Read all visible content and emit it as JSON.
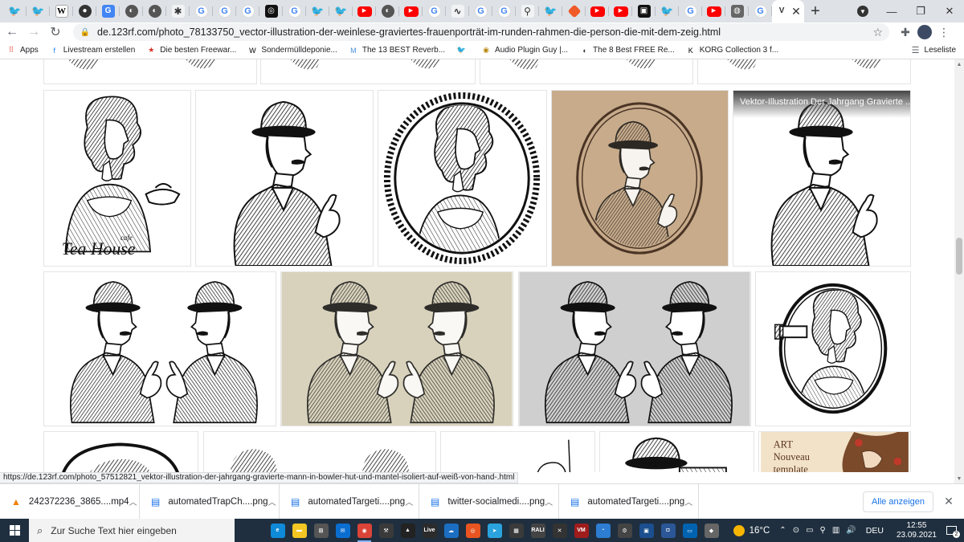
{
  "tabs": [
    {
      "icon": "twitter-icon",
      "glyph": "🐦",
      "cls": "twitter"
    },
    {
      "icon": "twitter-icon",
      "glyph": "🐦",
      "cls": "twitter"
    },
    {
      "icon": "wikipedia-icon",
      "glyph": "W",
      "cls": "wiki"
    },
    {
      "icon": "github-icon",
      "glyph": "●",
      "cls": "github"
    },
    {
      "icon": "translate-icon",
      "glyph": "G",
      "cls": "translate"
    },
    {
      "icon": "globe-icon",
      "glyph": "◐",
      "cls": "globe"
    },
    {
      "icon": "globe-icon",
      "glyph": "◐",
      "cls": "globe"
    },
    {
      "icon": "sparkle-icon",
      "glyph": "✱",
      "cls": "multi"
    },
    {
      "icon": "google-icon",
      "glyph": "G",
      "cls": "google"
    },
    {
      "icon": "google-icon",
      "glyph": "G",
      "cls": "google"
    },
    {
      "icon": "google-icon",
      "glyph": "G",
      "cls": "google"
    },
    {
      "icon": "openai-icon",
      "glyph": "◎",
      "cls": "dark"
    },
    {
      "icon": "google-icon",
      "glyph": "G",
      "cls": "google"
    },
    {
      "icon": "twitter-icon",
      "glyph": "🐦",
      "cls": "twitter"
    },
    {
      "icon": "twitter-icon",
      "glyph": "🐦",
      "cls": "twitter"
    },
    {
      "icon": "youtube-icon",
      "glyph": "▶",
      "cls": "youtube"
    },
    {
      "icon": "globe-icon",
      "glyph": "◐",
      "cls": "globe"
    },
    {
      "icon": "youtube-icon",
      "glyph": "▶",
      "cls": "youtube"
    },
    {
      "icon": "google-icon",
      "glyph": "G",
      "cls": "google"
    },
    {
      "icon": "signature-icon",
      "glyph": "∿",
      "cls": "multi"
    },
    {
      "icon": "google-icon",
      "glyph": "G",
      "cls": "google"
    },
    {
      "icon": "google-icon",
      "glyph": "G",
      "cls": "google"
    },
    {
      "icon": "figure-icon",
      "glyph": "⚲",
      "cls": "multi"
    },
    {
      "icon": "twitter-icon",
      "glyph": "🐦",
      "cls": "twitter"
    },
    {
      "icon": "git-icon",
      "glyph": "",
      "cls": "orange"
    },
    {
      "icon": "youtube-icon",
      "glyph": "▶",
      "cls": "youtube"
    },
    {
      "icon": "youtube-icon",
      "glyph": "▶",
      "cls": "youtube"
    },
    {
      "icon": "box-icon",
      "glyph": "▣",
      "cls": "dark"
    },
    {
      "icon": "twitter-icon",
      "glyph": "🐦",
      "cls": "twitter"
    },
    {
      "icon": "google-icon",
      "glyph": "G",
      "cls": "google"
    },
    {
      "icon": "youtube-icon",
      "glyph": "▶",
      "cls": "youtube"
    },
    {
      "icon": "gamepad-icon",
      "glyph": "◍",
      "cls": "gray"
    },
    {
      "icon": "google-icon",
      "glyph": "G",
      "cls": "google"
    }
  ],
  "active_tab": {
    "icon": "vector-icon",
    "glyph": "V"
  },
  "toolbar": {
    "url_host": "de.123rf.com",
    "url_path": "/photo_78133750_vector-illustration-der-weinlese-graviertes-frauenporträt-im-runden-rahmen-die-person-die-mit-dem-zeig.html"
  },
  "bookmarks": [
    {
      "label": "Apps",
      "icon": "apps-grid-icon",
      "glyph": "⠿",
      "color": "#ea4335"
    },
    {
      "label": "Livestream erstellen",
      "icon": "facebook-icon",
      "glyph": "f",
      "color": "#1877f2"
    },
    {
      "label": "Die besten Freewar...",
      "icon": "star-icon",
      "glyph": "★",
      "color": "#d93025"
    },
    {
      "label": "Sondermülldeponie...",
      "icon": "wikipedia-icon",
      "glyph": "W",
      "color": "#000000"
    },
    {
      "label": "The 13 BEST Reverb...",
      "icon": "m-icon",
      "glyph": "M",
      "color": "#4a90d9"
    },
    {
      "label": "",
      "icon": "twitter-icon",
      "glyph": "🐦",
      "color": "#1d9bf0"
    },
    {
      "label": "Audio Plugin Guy |...",
      "icon": "plugin-icon",
      "glyph": "◉",
      "color": "#b8860b"
    },
    {
      "label": "The 8 Best FREE Re...",
      "icon": "moon-icon",
      "glyph": "◖",
      "color": "#333333"
    },
    {
      "label": "KORG Collection 3 f...",
      "icon": "korg-icon",
      "glyph": "K",
      "color": "#000000"
    }
  ],
  "reading_list": "Leseliste",
  "tile_overlay_title": "Vektor-Illustration Der Jahrgang Gravierte ...",
  "status_url": "https://de.123rf.com/photo_57512821_vektor-illustration-der-jahrgang-gravierte-mann-in-bowler-hut-und-mantel-isoliert-auf-weiß-von-hand-.html",
  "tile_text": {
    "teahouse": "Tea House",
    "cafe": "cafe",
    "art_line1": "ART",
    "art_line2": "Nouveau",
    "art_line3": "template"
  },
  "downloads": [
    {
      "name": "242372236_3865....mp4",
      "icon": "vlc-icon",
      "glyph": "▲",
      "color": "#f08000"
    },
    {
      "name": "automatedTrapCh....png",
      "icon": "file-icon",
      "glyph": "▤",
      "color": "#1a73e8"
    },
    {
      "name": "automatedTargeti....png",
      "icon": "file-icon",
      "glyph": "▤",
      "color": "#1a73e8"
    },
    {
      "name": "twitter-socialmedi....png",
      "icon": "file-icon",
      "glyph": "▤",
      "color": "#1a73e8"
    },
    {
      "name": "automatedTargeti....png",
      "icon": "file-icon",
      "glyph": "▤",
      "color": "#1a73e8"
    }
  ],
  "show_all": "Alle anzeigen",
  "taskbar": {
    "search_placeholder": "Zur Suche Text hier eingeben",
    "apps": [
      {
        "icon": "edge-icon",
        "glyph": "e",
        "color": "#0f8ad8",
        "running": false
      },
      {
        "icon": "file-explorer-icon",
        "glyph": "▬",
        "color": "#f3c623",
        "running": false
      },
      {
        "icon": "store-icon",
        "glyph": "⊞",
        "color": "#555555",
        "running": false
      },
      {
        "icon": "mail-icon",
        "glyph": "✉",
        "color": "#0a6ed1",
        "running": false
      },
      {
        "icon": "chrome-icon",
        "glyph": "◉",
        "color": "#db4437",
        "running": true
      },
      {
        "icon": "tool-icon",
        "glyph": "⚒",
        "color": "#3a3a3a",
        "running": false
      },
      {
        "icon": "inkscape-icon",
        "glyph": "▲",
        "color": "#222222",
        "running": false
      },
      {
        "icon": "live-icon",
        "glyph": "Live",
        "color": "#2b2b2b",
        "running": false
      },
      {
        "icon": "cloud-icon",
        "glyph": "☁",
        "color": "#1b6ec2",
        "running": false
      },
      {
        "icon": "ubuntu-icon",
        "glyph": "◎",
        "color": "#e95420",
        "running": false
      },
      {
        "icon": "telegram-icon",
        "glyph": "➤",
        "color": "#2aa3df",
        "running": false
      },
      {
        "icon": "mixer-icon",
        "glyph": "▦",
        "color": "#3a3a3a",
        "running": false
      },
      {
        "icon": "rali-icon",
        "glyph": "RALI",
        "color": "#444444",
        "running": false
      },
      {
        "icon": "crossed-tools-icon",
        "glyph": "✕",
        "color": "#333333",
        "running": false
      },
      {
        "icon": "voicemeeter-icon",
        "glyph": "VM",
        "color": "#a01c1c",
        "running": false
      },
      {
        "icon": "chat-icon",
        "glyph": "◔",
        "color": "#2d7dd2",
        "running": false
      },
      {
        "icon": "settings-icon",
        "glyph": "⚙",
        "color": "#444444",
        "running": false
      },
      {
        "icon": "virtualbox-icon",
        "glyph": "▣",
        "color": "#1b4f8f",
        "running": false
      },
      {
        "icon": "webcam-icon",
        "glyph": "◘",
        "color": "#2b5797",
        "running": false
      },
      {
        "icon": "photos-icon",
        "glyph": "▭",
        "color": "#0063b1",
        "running": false
      },
      {
        "icon": "unity-icon",
        "glyph": "◆",
        "color": "#666666",
        "running": false
      }
    ],
    "temperature": "16°C",
    "language": "DEU",
    "time": "12:55",
    "date": "23.09.2021",
    "notification_count": "2"
  }
}
